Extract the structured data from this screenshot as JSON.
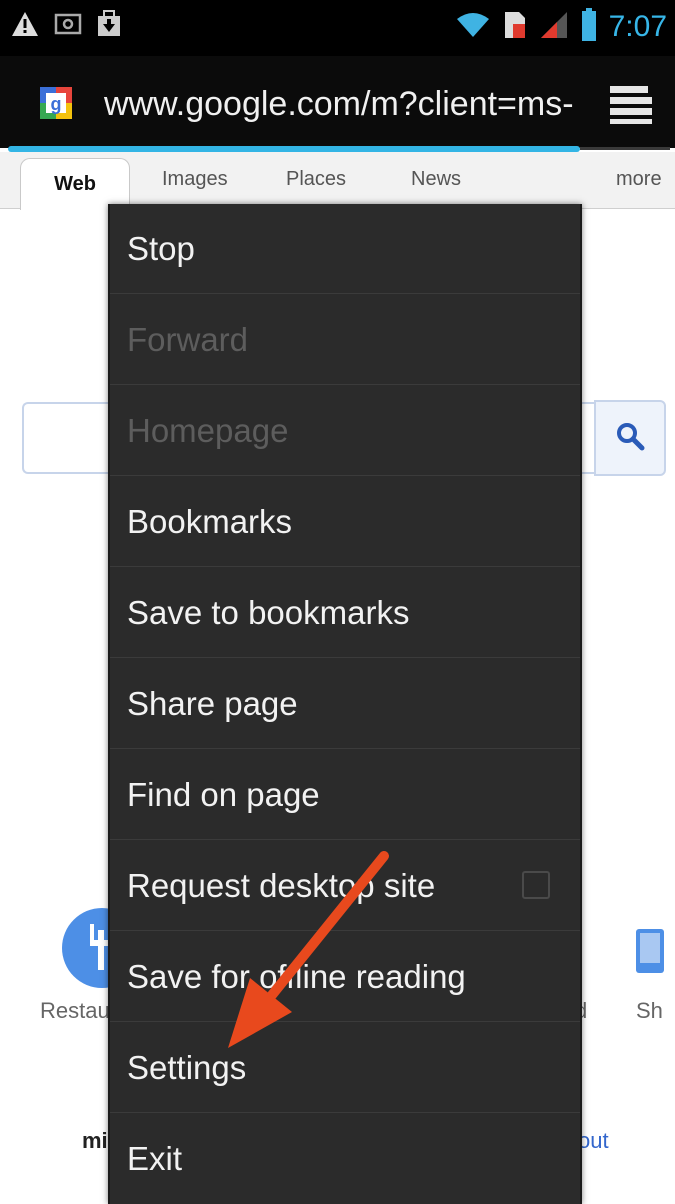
{
  "status_bar": {
    "time": "7:07",
    "left_icons": [
      "warning-icon",
      "image-icon",
      "download-icon"
    ],
    "right_icons": [
      "wifi-icon",
      "sim-icon",
      "signal-icon",
      "battery-icon"
    ],
    "clock_color": "#37b6e8"
  },
  "browser": {
    "url": "www.google.com/m?client=ms-",
    "favicon": "google-favicon",
    "tabs_button": "tabs-icon"
  },
  "google_tabs": [
    {
      "label": "Web",
      "active": true
    },
    {
      "label": "Images",
      "active": false
    },
    {
      "label": "Places",
      "active": false
    },
    {
      "label": "News",
      "active": false
    },
    {
      "label": "more",
      "active": false
    }
  ],
  "page": {
    "shortcut_left_label": "Restau",
    "shortcut_mid_label": "d",
    "shortcut_right_label": "Sh",
    "footer_left": "mi",
    "footer_right": "out"
  },
  "menu": {
    "items": [
      {
        "label": "Stop",
        "enabled": true
      },
      {
        "label": "Forward",
        "enabled": false
      },
      {
        "label": "Homepage",
        "enabled": false
      },
      {
        "label": "Bookmarks",
        "enabled": true
      },
      {
        "label": "Save to bookmarks",
        "enabled": true
      },
      {
        "label": "Share page",
        "enabled": true
      },
      {
        "label": "Find on page",
        "enabled": true
      },
      {
        "label": "Request desktop site",
        "enabled": true,
        "checked": false
      },
      {
        "label": "Save for offline reading",
        "enabled": true
      },
      {
        "label": "Settings",
        "enabled": true
      },
      {
        "label": "Exit",
        "enabled": true
      }
    ]
  },
  "colors": {
    "menu_bg": "#2b2b2b",
    "accent": "#33b5e5",
    "annotation_arrow": "#e8491d"
  }
}
